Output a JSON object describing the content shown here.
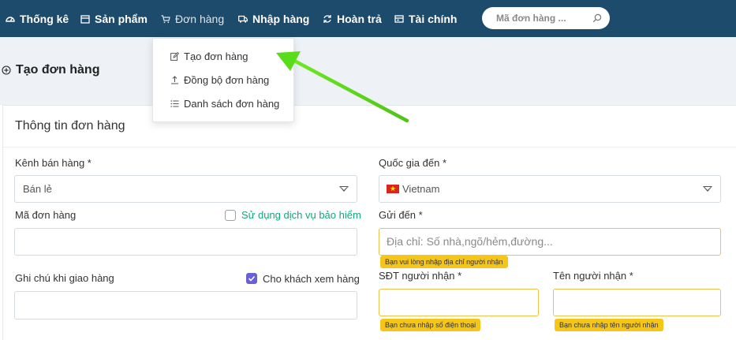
{
  "nav": {
    "items": [
      {
        "label": "Thống kê",
        "icon": "dashboard-icon"
      },
      {
        "label": "Sản phẩm",
        "icon": "box-icon"
      },
      {
        "label": "Đơn hàng",
        "icon": "cart-icon"
      },
      {
        "label": "Nhập hàng",
        "icon": "truck-icon"
      },
      {
        "label": "Hoàn trả",
        "icon": "refresh-icon"
      },
      {
        "label": "Tài chính",
        "icon": "wallet-icon"
      }
    ],
    "search_placeholder": "Mã đơn hàng ..."
  },
  "dropdown": {
    "items": [
      {
        "label": "Tạo đơn hàng",
        "icon": "edit-icon"
      },
      {
        "label": "Đồng bộ đơn hàng",
        "icon": "upload-icon"
      },
      {
        "label": "Danh sách đơn hàng",
        "icon": "list-icon"
      }
    ]
  },
  "page": {
    "title": "Tạo đơn hàng",
    "card_title": "Thông tin đơn hàng"
  },
  "form": {
    "channel_label": "Kênh bán hàng *",
    "channel_value": "Bán lẻ",
    "order_code_label": "Mã đơn hàng",
    "insurance_label": "Sử dụng dịch vụ bảo hiểm",
    "insurance_checked": false,
    "note_label": "Ghi chú khi giao hàng",
    "show_customer_label": "Cho khách xem hàng",
    "show_customer_checked": true,
    "country_label": "Quốc gia đến *",
    "country_value": "Vietnam",
    "address_label": "Gửi đến *",
    "address_placeholder": "Địa chỉ: Số nhà,ngõ/hẻm,đường...",
    "address_error": "Bạn vui lòng nhập địa chỉ người nhận",
    "phone_label": "SĐT người nhận *",
    "phone_error": "Bạn chưa nhập số điện thoại",
    "name_label": "Tên người nhận *",
    "name_error": "Bạn chưa nhập tên người nhận"
  },
  "colors": {
    "nav_bg": "#1d4b6b",
    "accent_green": "#1aa37a",
    "warning": "#f5c518",
    "checkbox": "#6b5fd6",
    "arrow": "#5bdc1a"
  }
}
